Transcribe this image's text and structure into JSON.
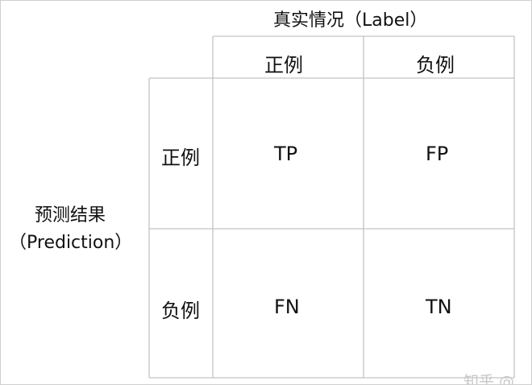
{
  "title": "真实情况（Label）",
  "y_axis": {
    "line1": "预测结果",
    "line2": "（Prediction）"
  },
  "columns": [
    "正例",
    "负例"
  ],
  "rows": [
    "正例",
    "负例"
  ],
  "cells": [
    [
      "TP",
      "FP"
    ],
    [
      "FN",
      "TN"
    ]
  ],
  "watermark": "知乎 @…"
}
